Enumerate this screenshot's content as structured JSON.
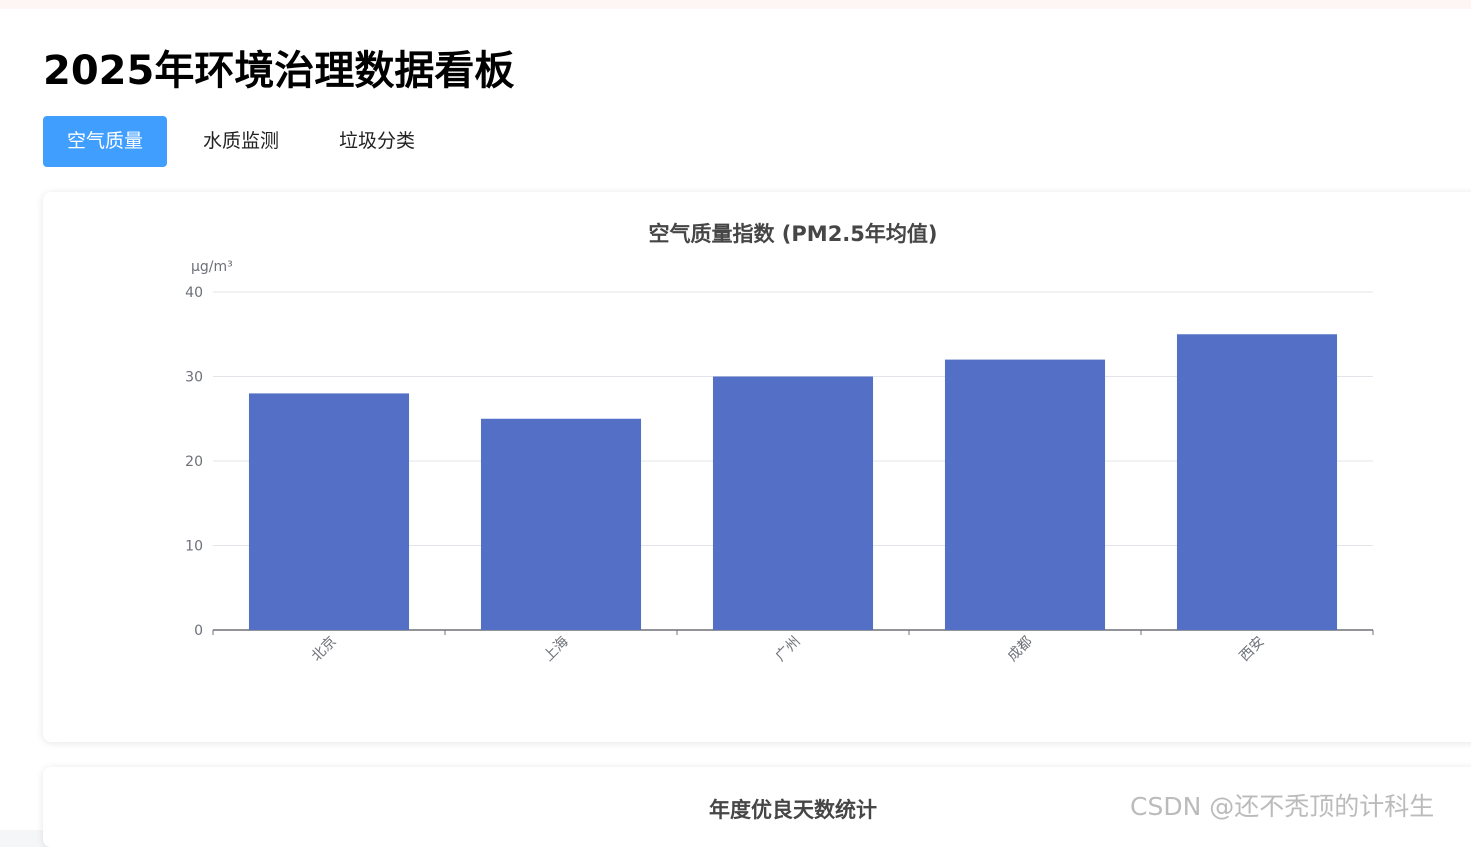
{
  "dashboard": {
    "title": "2025年环境治理数据看板"
  },
  "tabs": [
    {
      "label": "空气质量",
      "active": true
    },
    {
      "label": "水质监测",
      "active": false
    },
    {
      "label": "垃圾分类",
      "active": false
    }
  ],
  "chart_data": [
    {
      "type": "bar",
      "title": "空气质量指数 (PM2.5年均值)",
      "ylabel": "μg/m³",
      "xlabel": "",
      "categories": [
        "北京",
        "上海",
        "广州",
        "成都",
        "西安"
      ],
      "values": [
        28,
        25,
        30,
        32,
        35
      ],
      "ylim": [
        0,
        40
      ],
      "yticks": [
        0,
        10,
        20,
        30,
        40
      ],
      "grid": true,
      "color": "#5470c6"
    },
    {
      "type": "bar",
      "title": "年度优良天数统计"
    }
  ],
  "watermark": "CSDN @还不秃顶的计科生"
}
